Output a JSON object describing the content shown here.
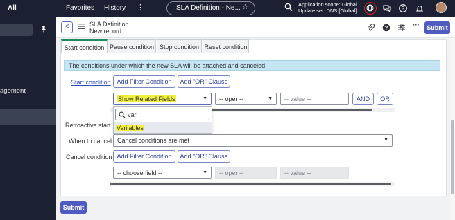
{
  "topbar": {
    "all_label": "All",
    "favorites_label": "Favorites",
    "history_label": "History",
    "more_glyph": "⋮",
    "record_pill": "SLA Definition - Ne...",
    "star_glyph": "☆",
    "scope_line1": "Application scope: Global",
    "scope_line2": "Update set: DNS [Global]"
  },
  "header": {
    "back_glyph": "<",
    "title": "SLA Definition",
    "subtitle": "New record",
    "more_glyph": "···",
    "submit_label": "Submit"
  },
  "tabs": [
    {
      "label": "Start condition",
      "active": true
    },
    {
      "label": "Pause condition",
      "active": false
    },
    {
      "label": "Stop condition",
      "active": false
    },
    {
      "label": "Reset condition",
      "active": false
    }
  ],
  "info_text": "The conditions under which the new SLA will be attached and canceled",
  "start_condition": {
    "label": "Start condition",
    "add_filter_label": "Add Filter Condition",
    "add_or_label": "Add \"OR\" Clause",
    "field_value": "Show Related Fields",
    "operator_value": "-- oper --",
    "value_placeholder": "-- value --",
    "and_label": "AND",
    "or_label": "OR"
  },
  "dropdown": {
    "search_value": "vari",
    "option_highlight": "Vari",
    "option_rest": "ables"
  },
  "retroactive": {
    "label": "Retroactive start"
  },
  "when_to_cancel": {
    "label": "When to cancel",
    "value": "Cancel conditions are met"
  },
  "cancel_condition": {
    "label": "Cancel condition",
    "add_filter_label": "Add Filter Condition",
    "add_or_label": "Add \"OR\" Clause",
    "field_value": "-- choose field --",
    "operator_value": "-- oper --",
    "value_placeholder": "-- value --"
  },
  "footer": {
    "submit_label": "Submit"
  },
  "leftnav": {
    "partial_item": "agement"
  },
  "colors": {
    "nav_bg": "#1b2132",
    "accent": "#4f5bc0",
    "info_bg": "#c5e5f3",
    "highlight": "#f4ef3c",
    "active_tab": "#1f8a5d"
  }
}
